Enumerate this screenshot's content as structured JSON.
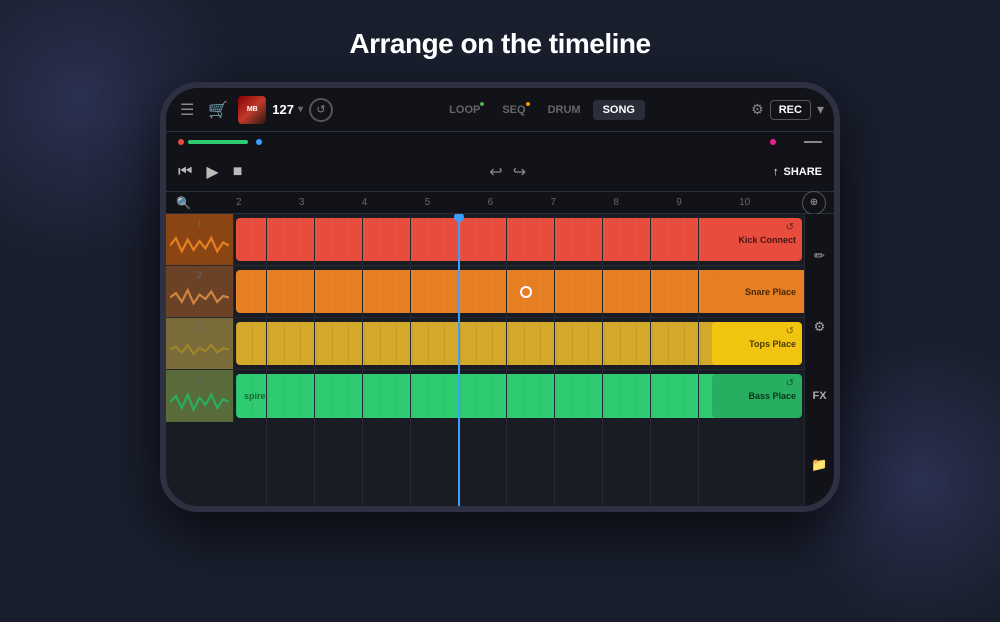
{
  "page": {
    "title": "Arrange on the timeline",
    "bg_color": "#1a1f2e"
  },
  "app": {
    "bpm": "127",
    "album_art_text": "MB",
    "nav_tabs": [
      {
        "label": "LOOP",
        "dot": "green",
        "active": false
      },
      {
        "label": "SEQ",
        "dot": "orange",
        "active": false
      },
      {
        "label": "DRUM",
        "dot": null,
        "active": false
      },
      {
        "label": "SONG",
        "dot": null,
        "active": true
      }
    ],
    "rec_label": "REC",
    "share_label": "SHARE"
  },
  "tracks": [
    {
      "id": 1,
      "color": "#e74c3c",
      "block1_label": "Kick Connect",
      "block1_left": 0,
      "block1_width": 85
    },
    {
      "id": 2,
      "color": "#e67e22",
      "block1_label": "Snare Place",
      "block1_left": 0,
      "block1_width": 100
    },
    {
      "id": 3,
      "color": "#f1c40f",
      "block1_label": "Tops Place",
      "block1_left": 0,
      "block1_width": 85
    },
    {
      "id": 4,
      "color": "#2ecc71",
      "block1_label": "Bass Place",
      "block1_left": 0,
      "block1_width": 85,
      "block1_prefix": "spire"
    }
  ],
  "timeline": {
    "numbers": [
      "2",
      "3",
      "4",
      "5",
      "6",
      "7",
      "8",
      "9",
      "10"
    ]
  },
  "controls": {
    "play": "▶",
    "stop": "■",
    "rewind": "⏮"
  },
  "right_panel": {
    "fx_label": "FX"
  }
}
